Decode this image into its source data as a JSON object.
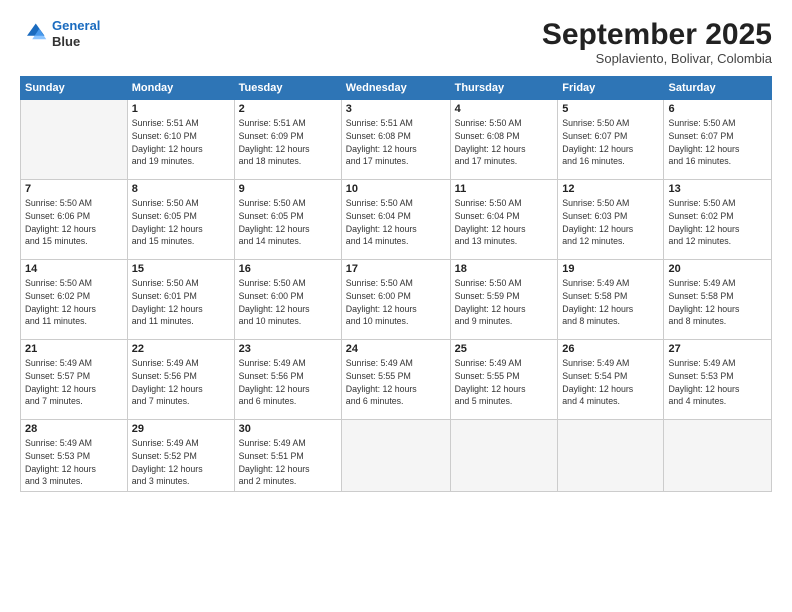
{
  "header": {
    "logo_line1": "General",
    "logo_line2": "Blue",
    "month": "September 2025",
    "location": "Soplaviento, Bolivar, Colombia"
  },
  "weekdays": [
    "Sunday",
    "Monday",
    "Tuesday",
    "Wednesday",
    "Thursday",
    "Friday",
    "Saturday"
  ],
  "weeks": [
    [
      {
        "day": "",
        "info": ""
      },
      {
        "day": "1",
        "info": "Sunrise: 5:51 AM\nSunset: 6:10 PM\nDaylight: 12 hours\nand 19 minutes."
      },
      {
        "day": "2",
        "info": "Sunrise: 5:51 AM\nSunset: 6:09 PM\nDaylight: 12 hours\nand 18 minutes."
      },
      {
        "day": "3",
        "info": "Sunrise: 5:51 AM\nSunset: 6:08 PM\nDaylight: 12 hours\nand 17 minutes."
      },
      {
        "day": "4",
        "info": "Sunrise: 5:50 AM\nSunset: 6:08 PM\nDaylight: 12 hours\nand 17 minutes."
      },
      {
        "day": "5",
        "info": "Sunrise: 5:50 AM\nSunset: 6:07 PM\nDaylight: 12 hours\nand 16 minutes."
      },
      {
        "day": "6",
        "info": "Sunrise: 5:50 AM\nSunset: 6:07 PM\nDaylight: 12 hours\nand 16 minutes."
      }
    ],
    [
      {
        "day": "7",
        "info": "Sunrise: 5:50 AM\nSunset: 6:06 PM\nDaylight: 12 hours\nand 15 minutes."
      },
      {
        "day": "8",
        "info": "Sunrise: 5:50 AM\nSunset: 6:05 PM\nDaylight: 12 hours\nand 15 minutes."
      },
      {
        "day": "9",
        "info": "Sunrise: 5:50 AM\nSunset: 6:05 PM\nDaylight: 12 hours\nand 14 minutes."
      },
      {
        "day": "10",
        "info": "Sunrise: 5:50 AM\nSunset: 6:04 PM\nDaylight: 12 hours\nand 14 minutes."
      },
      {
        "day": "11",
        "info": "Sunrise: 5:50 AM\nSunset: 6:04 PM\nDaylight: 12 hours\nand 13 minutes."
      },
      {
        "day": "12",
        "info": "Sunrise: 5:50 AM\nSunset: 6:03 PM\nDaylight: 12 hours\nand 12 minutes."
      },
      {
        "day": "13",
        "info": "Sunrise: 5:50 AM\nSunset: 6:02 PM\nDaylight: 12 hours\nand 12 minutes."
      }
    ],
    [
      {
        "day": "14",
        "info": "Sunrise: 5:50 AM\nSunset: 6:02 PM\nDaylight: 12 hours\nand 11 minutes."
      },
      {
        "day": "15",
        "info": "Sunrise: 5:50 AM\nSunset: 6:01 PM\nDaylight: 12 hours\nand 11 minutes."
      },
      {
        "day": "16",
        "info": "Sunrise: 5:50 AM\nSunset: 6:00 PM\nDaylight: 12 hours\nand 10 minutes."
      },
      {
        "day": "17",
        "info": "Sunrise: 5:50 AM\nSunset: 6:00 PM\nDaylight: 12 hours\nand 10 minutes."
      },
      {
        "day": "18",
        "info": "Sunrise: 5:50 AM\nSunset: 5:59 PM\nDaylight: 12 hours\nand 9 minutes."
      },
      {
        "day": "19",
        "info": "Sunrise: 5:49 AM\nSunset: 5:58 PM\nDaylight: 12 hours\nand 8 minutes."
      },
      {
        "day": "20",
        "info": "Sunrise: 5:49 AM\nSunset: 5:58 PM\nDaylight: 12 hours\nand 8 minutes."
      }
    ],
    [
      {
        "day": "21",
        "info": "Sunrise: 5:49 AM\nSunset: 5:57 PM\nDaylight: 12 hours\nand 7 minutes."
      },
      {
        "day": "22",
        "info": "Sunrise: 5:49 AM\nSunset: 5:56 PM\nDaylight: 12 hours\nand 7 minutes."
      },
      {
        "day": "23",
        "info": "Sunrise: 5:49 AM\nSunset: 5:56 PM\nDaylight: 12 hours\nand 6 minutes."
      },
      {
        "day": "24",
        "info": "Sunrise: 5:49 AM\nSunset: 5:55 PM\nDaylight: 12 hours\nand 6 minutes."
      },
      {
        "day": "25",
        "info": "Sunrise: 5:49 AM\nSunset: 5:55 PM\nDaylight: 12 hours\nand 5 minutes."
      },
      {
        "day": "26",
        "info": "Sunrise: 5:49 AM\nSunset: 5:54 PM\nDaylight: 12 hours\nand 4 minutes."
      },
      {
        "day": "27",
        "info": "Sunrise: 5:49 AM\nSunset: 5:53 PM\nDaylight: 12 hours\nand 4 minutes."
      }
    ],
    [
      {
        "day": "28",
        "info": "Sunrise: 5:49 AM\nSunset: 5:53 PM\nDaylight: 12 hours\nand 3 minutes."
      },
      {
        "day": "29",
        "info": "Sunrise: 5:49 AM\nSunset: 5:52 PM\nDaylight: 12 hours\nand 3 minutes."
      },
      {
        "day": "30",
        "info": "Sunrise: 5:49 AM\nSunset: 5:51 PM\nDaylight: 12 hours\nand 2 minutes."
      },
      {
        "day": "",
        "info": ""
      },
      {
        "day": "",
        "info": ""
      },
      {
        "day": "",
        "info": ""
      },
      {
        "day": "",
        "info": ""
      }
    ]
  ]
}
